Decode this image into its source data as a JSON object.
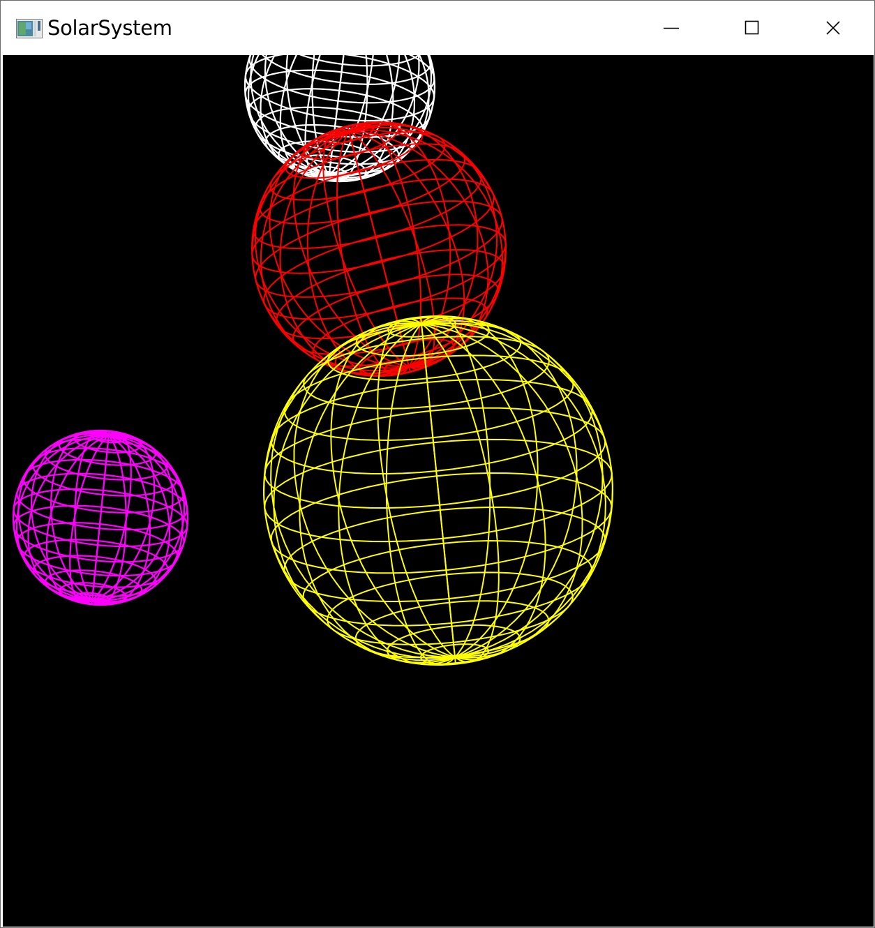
{
  "window": {
    "title": "SolarSystem",
    "app_icon": "window-app-icon",
    "controls": [
      {
        "name": "minimize-button",
        "icon": "minimize-icon"
      },
      {
        "name": "maximize-button",
        "icon": "maximize-icon"
      },
      {
        "name": "close-button",
        "icon": "close-icon"
      }
    ]
  },
  "scene": {
    "background": "#000000",
    "bodies": [
      {
        "name": "white-planet",
        "color": "#ffffff"
      },
      {
        "name": "red-planet",
        "color": "#ff0000"
      },
      {
        "name": "yellow-sun",
        "color": "#ffff00"
      },
      {
        "name": "magenta-planet",
        "color": "#ff00ff"
      }
    ]
  }
}
